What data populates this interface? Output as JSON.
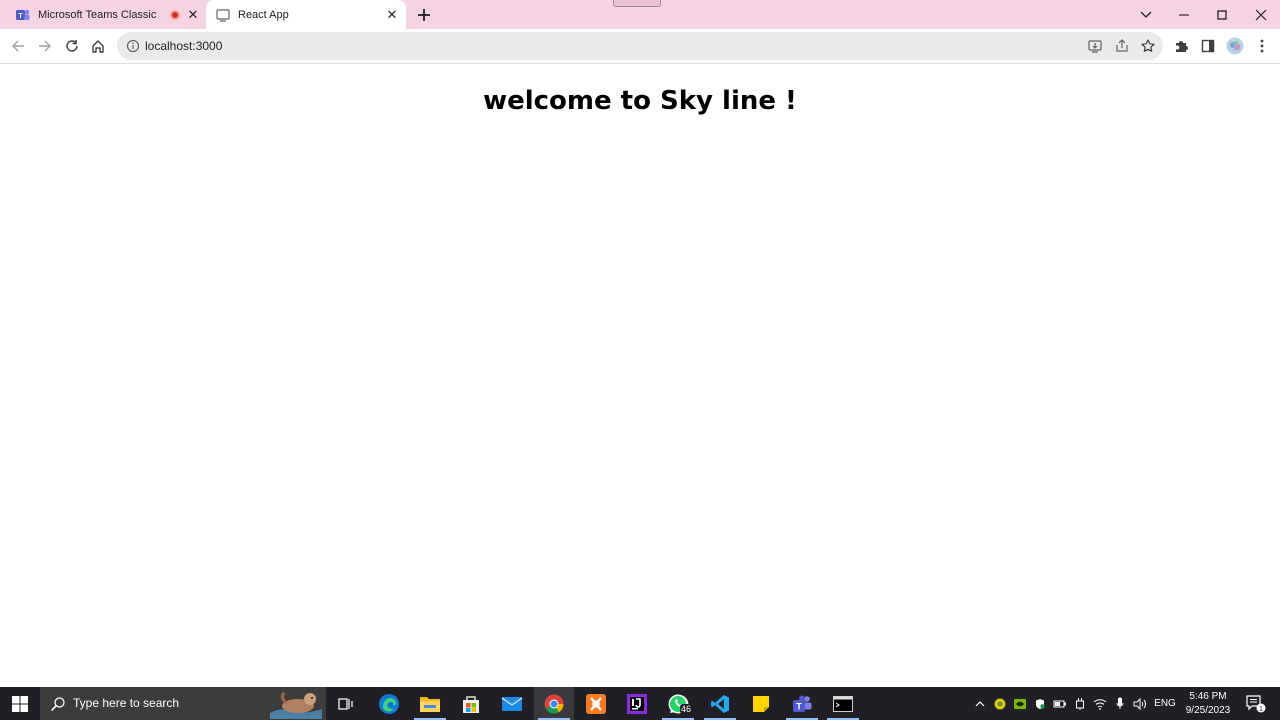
{
  "browser": {
    "tabs": [
      {
        "title": "Microsoft Teams Classic",
        "active": false,
        "recording": true
      },
      {
        "title": "React App",
        "active": true
      }
    ],
    "address": {
      "url": "localhost:3000"
    },
    "icons": {
      "tab1_favicon": "teams-icon",
      "tab2_favicon": "react-app-favicon",
      "back": "back-arrow-icon",
      "forward": "forward-arrow-icon",
      "reload": "reload-icon",
      "home": "home-icon",
      "site_info": "info-icon",
      "install": "install-app-icon",
      "share": "share-icon",
      "bookmark": "star-icon",
      "extensions": "puzzle-icon",
      "side_panel": "side-panel-icon",
      "profile": "avatar",
      "menu": "kebab-menu-icon"
    },
    "colors": {
      "tabstrip": "#f6d3e3",
      "omnibox": "#eaeaea",
      "record": "#d93025"
    }
  },
  "page": {
    "heading": "welcome to Sky line !"
  },
  "taskbar": {
    "search_placeholder": "Type here to search",
    "apps": [
      "task-view",
      "edge",
      "file-explorer",
      "microsoft-store",
      "mail",
      "chrome",
      "xampp",
      "intellij",
      "whatsapp",
      "vscode",
      "sticky-notes",
      "teams",
      "terminal"
    ],
    "whatsapp_badge": "46",
    "language": "ENG",
    "time": "5:46 PM",
    "date": "9/25/2023",
    "notification_count": "1"
  }
}
